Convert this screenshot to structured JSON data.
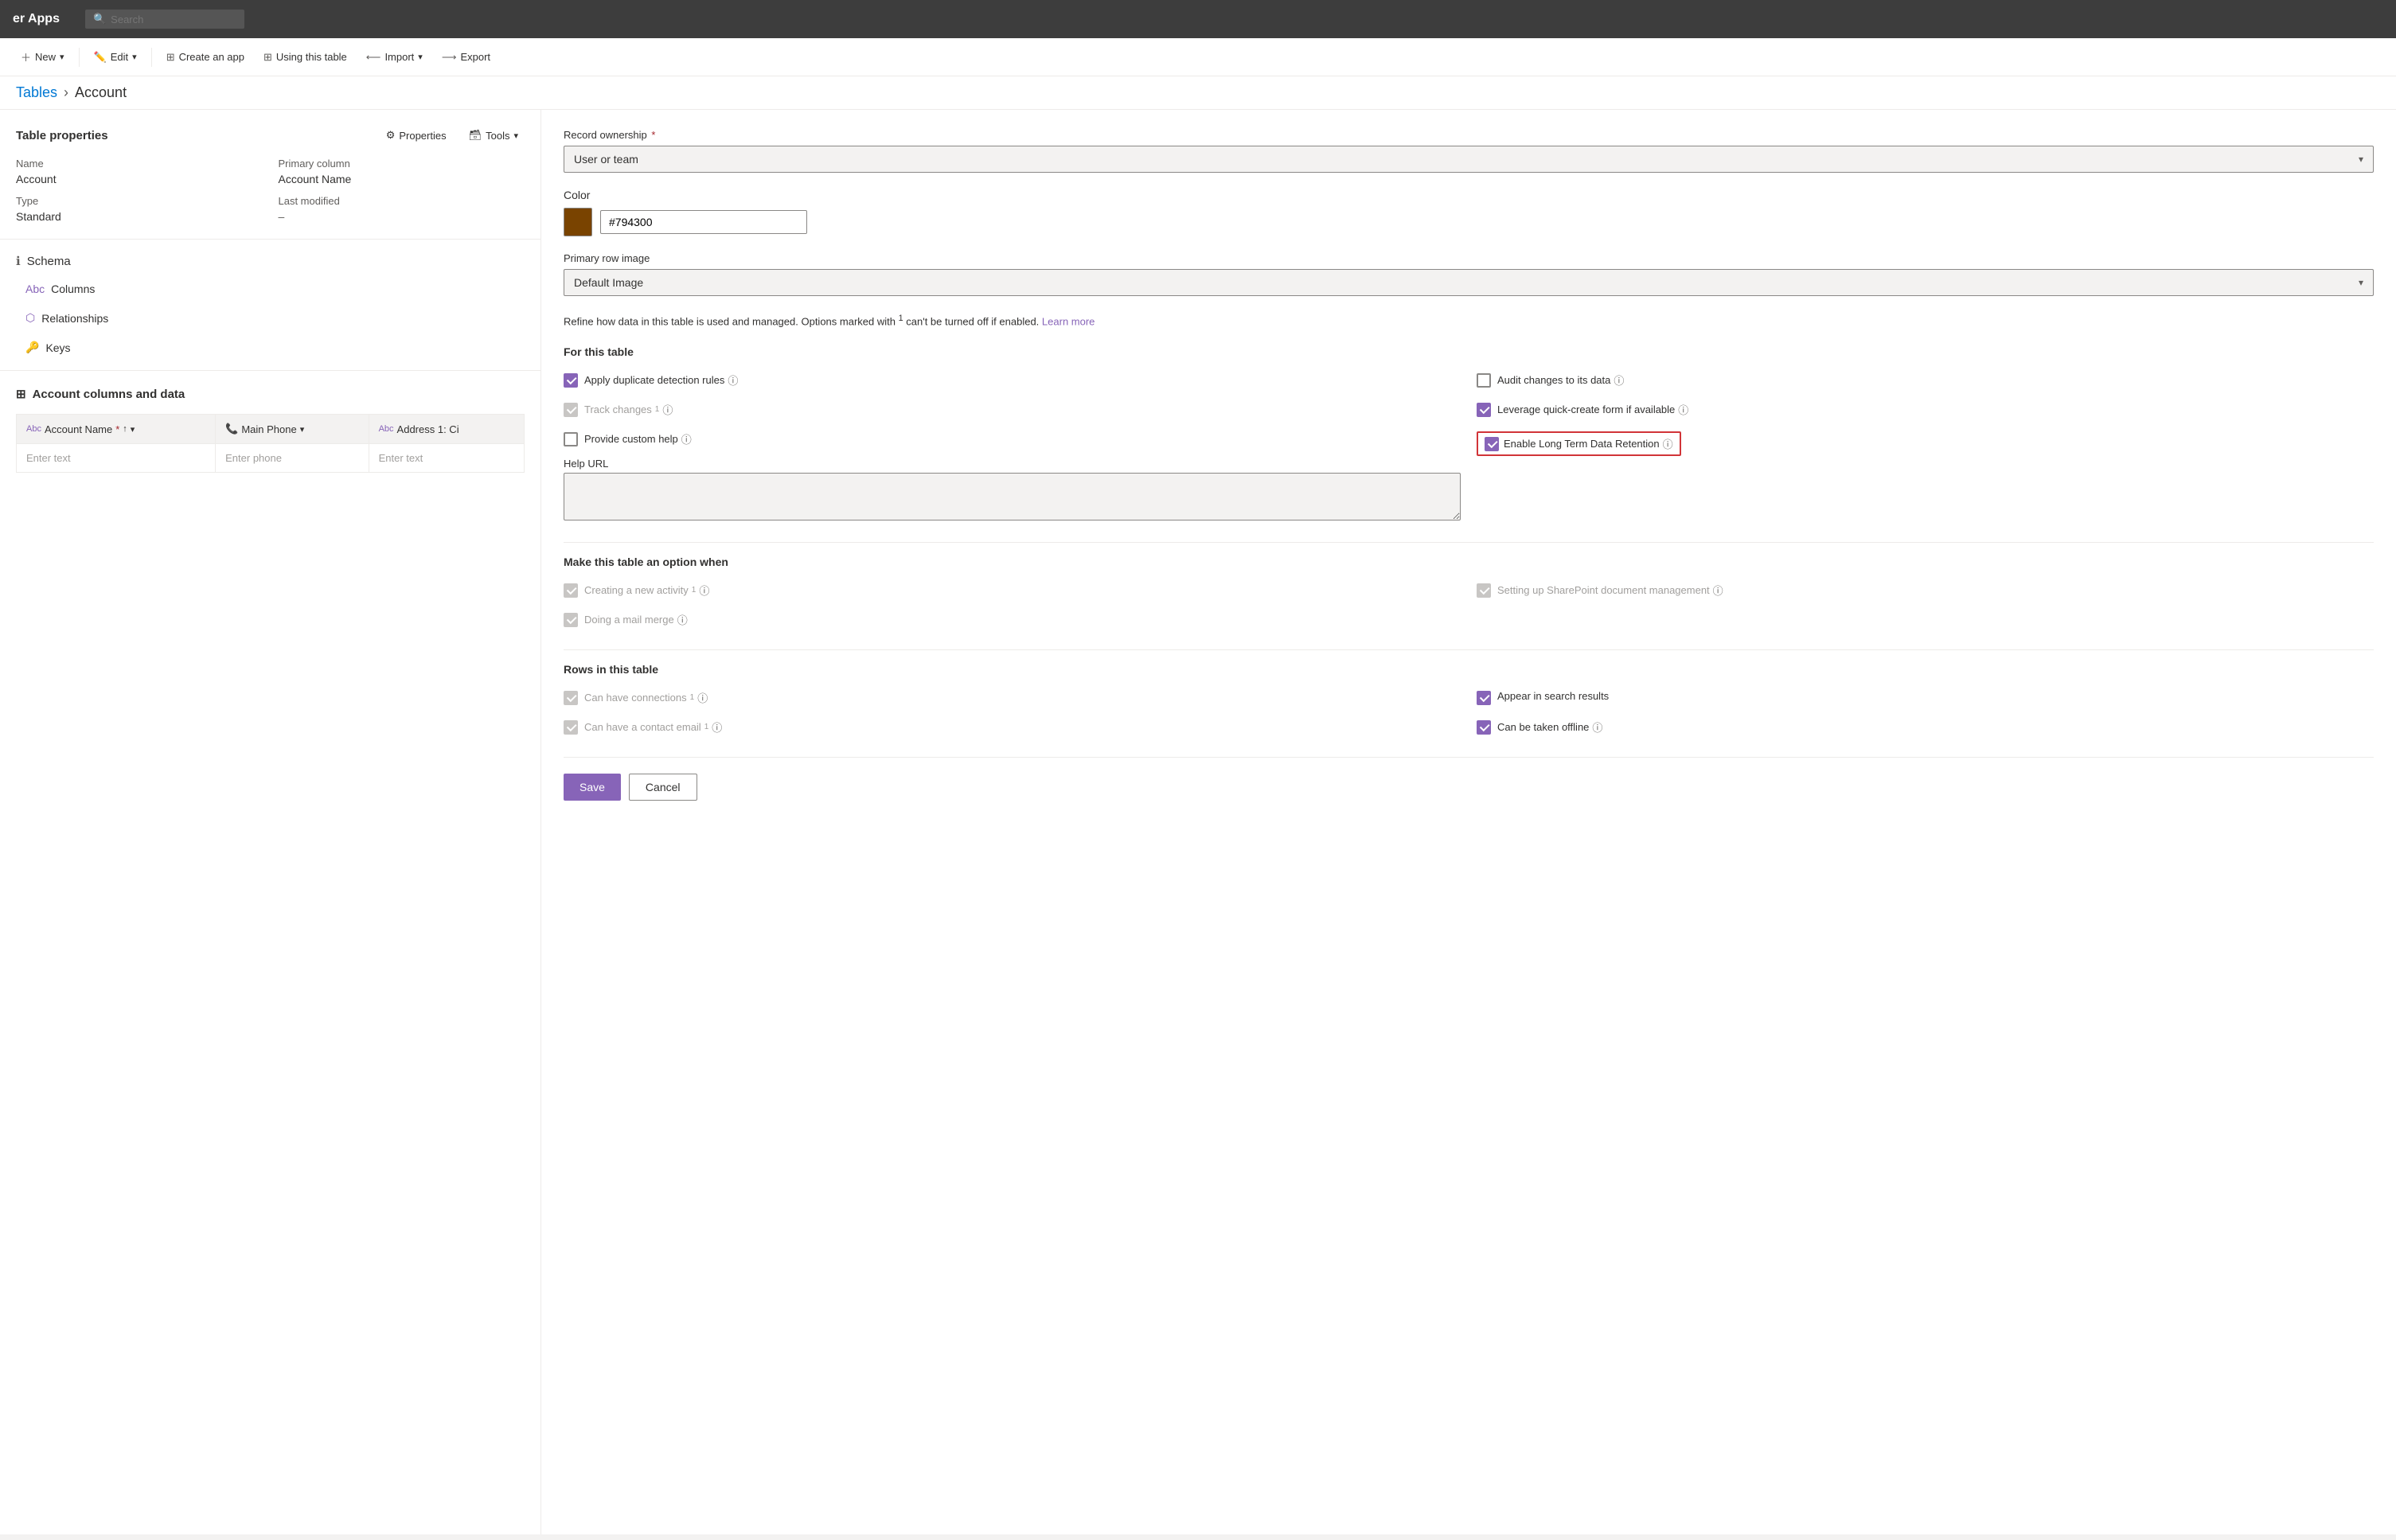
{
  "header": {
    "app_title": "er Apps",
    "search_placeholder": "Search"
  },
  "toolbar": {
    "new_label": "New",
    "edit_label": "Edit",
    "create_app_label": "Create an app",
    "using_this_table_label": "Using this table",
    "import_label": "Import",
    "export_label": "Export"
  },
  "breadcrumb": {
    "parent": "Tables",
    "current": "Account"
  },
  "table_properties": {
    "section_title": "Table properties",
    "properties_btn": "Properties",
    "tools_btn": "Tools",
    "name_label": "Name",
    "name_value": "Account",
    "primary_column_label": "Primary column",
    "primary_column_value": "Account Name",
    "type_label": "Type",
    "type_value": "Standard",
    "last_modified_label": "Last modified",
    "last_modified_value": "–"
  },
  "schema": {
    "header": "Schema",
    "columns_label": "Columns",
    "relationships_label": "Relationships",
    "keys_label": "Keys"
  },
  "data_section": {
    "title": "Account columns and data",
    "columns": [
      {
        "label": "Account Name",
        "type": "Abc",
        "required": true
      },
      {
        "label": "Main Phone",
        "type": "phone"
      },
      {
        "label": "Address 1: Ci",
        "type": "Abc"
      }
    ],
    "placeholder_account": "Enter text",
    "placeholder_phone": "Enter phone",
    "placeholder_address": "Enter text"
  },
  "side_panel": {
    "record_ownership_label": "Record ownership",
    "record_ownership_required": true,
    "record_ownership_value": "User or team",
    "color_label": "Color",
    "color_hex": "#794300",
    "primary_row_image_label": "Primary row image",
    "primary_row_image_value": "Default Image",
    "info_text": "Refine how data in this table is used and managed. Options marked with",
    "info_superscript": "1",
    "info_text2": "can't be turned off if enabled.",
    "learn_more_label": "Learn more",
    "for_this_table_title": "For this table",
    "options": {
      "apply_duplicate": {
        "label": "Apply duplicate detection rules",
        "checked": true,
        "disabled": false
      },
      "audit_changes": {
        "label": "Audit changes to its data",
        "checked": false,
        "disabled": false
      },
      "track_changes": {
        "label": "Track changes",
        "superscript": "1",
        "checked": false,
        "disabled": true
      },
      "leverage_quick_create": {
        "label": "Leverage quick-create form if available",
        "checked": true,
        "disabled": false
      },
      "provide_custom_help": {
        "label": "Provide custom help",
        "checked": false,
        "disabled": false
      },
      "enable_ltdr": {
        "label": "Enable Long Term Data Retention",
        "checked": true,
        "disabled": false,
        "highlighted": true
      },
      "help_url_label": "Help URL"
    },
    "make_option_title": "Make this table an option when",
    "make_options": {
      "creating_activity": {
        "label": "Creating a new activity",
        "superscript": "1",
        "checked": true,
        "disabled": true
      },
      "sharepoint": {
        "label": "Setting up SharePoint document management",
        "checked": true,
        "disabled": true
      },
      "mail_merge": {
        "label": "Doing a mail merge",
        "checked": true,
        "disabled": true
      }
    },
    "rows_title": "Rows in this table",
    "row_options": {
      "can_have_connections": {
        "label": "Can have connections",
        "superscript": "1",
        "checked": true,
        "disabled": true
      },
      "appear_in_search": {
        "label": "Appear in search results",
        "checked": true,
        "disabled": false
      },
      "can_have_contact_email": {
        "label": "Can have a contact email",
        "superscript": "1",
        "checked": true,
        "disabled": true
      },
      "can_be_taken_offline": {
        "label": "Can be taken offline",
        "checked": true,
        "disabled": false
      }
    },
    "save_label": "Save",
    "cancel_label": "Cancel"
  }
}
